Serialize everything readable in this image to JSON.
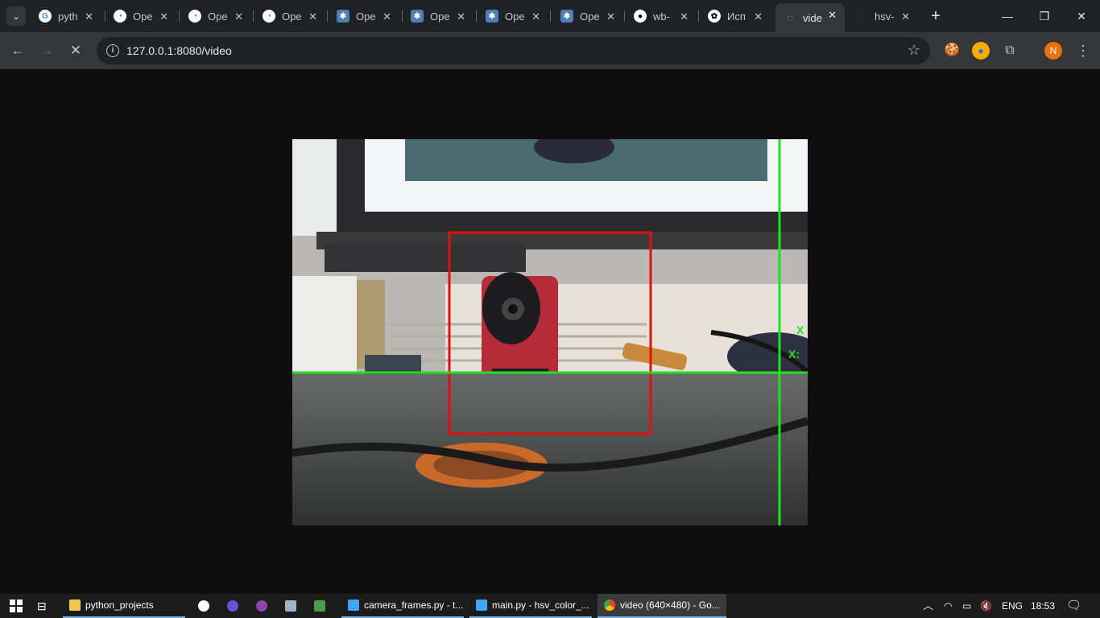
{
  "tabs": [
    {
      "title": "pyth",
      "icon": "google-icon",
      "favicon_color": "#ffffff",
      "favicon_text": "G"
    },
    {
      "title": "Ope",
      "icon": "opencv-icon",
      "favicon_color": "#ffffff",
      "favicon_text": "◔"
    },
    {
      "title": "Ope",
      "icon": "opencv-icon",
      "favicon_color": "#ffffff",
      "favicon_text": "◔"
    },
    {
      "title": "Ope",
      "icon": "opencv-icon",
      "favicon_color": "#ffffff",
      "favicon_text": "◔"
    },
    {
      "title": "Ope",
      "icon": "docs-icon",
      "favicon_color": "#8ab4f8",
      "favicon_text": "✱"
    },
    {
      "title": "Ope",
      "icon": "docs-icon",
      "favicon_color": "#8ab4f8",
      "favicon_text": "✱"
    },
    {
      "title": "Ope",
      "icon": "docs-icon",
      "favicon_color": "#8ab4f8",
      "favicon_text": "✱"
    },
    {
      "title": "Ope",
      "icon": "docs-icon",
      "favicon_color": "#8ab4f8",
      "favicon_text": "✱"
    },
    {
      "title": "wb-",
      "icon": "github-icon",
      "favicon_color": "#ffffff",
      "favicon_text": "●"
    },
    {
      "title": "Исп",
      "icon": "chatgpt-icon",
      "favicon_color": "#ffffff",
      "favicon_text": "✿"
    },
    {
      "title": "vide",
      "icon": "loading-icon",
      "favicon_color": "#9aa0a6",
      "favicon_text": "◌",
      "active": true
    },
    {
      "title": "hsv-",
      "icon": "loading-icon",
      "favicon_color": "#3c4043",
      "favicon_text": "◌"
    }
  ],
  "toolbar": {
    "url": "127.0.0.1:8080/video"
  },
  "taskbar": {
    "items": [
      {
        "label": "python_projects",
        "icon": "folder-icon",
        "color": "#f3c64f"
      },
      {
        "label": "camera_frames.py - t...",
        "icon": "vscode-icon",
        "color": "#3ea6ff"
      },
      {
        "label": "main.py - hsv_color_...",
        "icon": "vscode-icon",
        "color": "#3ea6ff"
      },
      {
        "label": "video (640×480) - Go...",
        "icon": "chrome-icon",
        "color": "#4caf50"
      }
    ],
    "language": "ENG",
    "time": "18:53"
  },
  "video": {
    "overlay_color_box": "#e01010",
    "overlay_color_cross": "#22e022",
    "markers": [
      "X",
      "X:"
    ]
  },
  "colors": {
    "tabbar_bg": "#202124",
    "toolbar_bg": "#35363a",
    "page_bg": "#0e0e0e",
    "profile_avatar": "#e8710a"
  },
  "profile_initial": "N"
}
